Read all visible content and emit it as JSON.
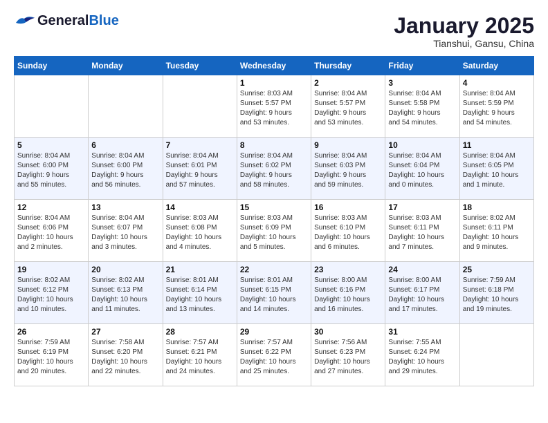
{
  "header": {
    "logo_general": "General",
    "logo_blue": "Blue",
    "calendar_title": "January 2025",
    "calendar_subtitle": "Tianshui, Gansu, China"
  },
  "days_of_week": [
    "Sunday",
    "Monday",
    "Tuesday",
    "Wednesday",
    "Thursday",
    "Friday",
    "Saturday"
  ],
  "weeks": [
    [
      {
        "day": "",
        "info": ""
      },
      {
        "day": "",
        "info": ""
      },
      {
        "day": "",
        "info": ""
      },
      {
        "day": "1",
        "info": "Sunrise: 8:03 AM\nSunset: 5:57 PM\nDaylight: 9 hours\nand 53 minutes."
      },
      {
        "day": "2",
        "info": "Sunrise: 8:04 AM\nSunset: 5:57 PM\nDaylight: 9 hours\nand 53 minutes."
      },
      {
        "day": "3",
        "info": "Sunrise: 8:04 AM\nSunset: 5:58 PM\nDaylight: 9 hours\nand 54 minutes."
      },
      {
        "day": "4",
        "info": "Sunrise: 8:04 AM\nSunset: 5:59 PM\nDaylight: 9 hours\nand 54 minutes."
      }
    ],
    [
      {
        "day": "5",
        "info": "Sunrise: 8:04 AM\nSunset: 6:00 PM\nDaylight: 9 hours\nand 55 minutes."
      },
      {
        "day": "6",
        "info": "Sunrise: 8:04 AM\nSunset: 6:00 PM\nDaylight: 9 hours\nand 56 minutes."
      },
      {
        "day": "7",
        "info": "Sunrise: 8:04 AM\nSunset: 6:01 PM\nDaylight: 9 hours\nand 57 minutes."
      },
      {
        "day": "8",
        "info": "Sunrise: 8:04 AM\nSunset: 6:02 PM\nDaylight: 9 hours\nand 58 minutes."
      },
      {
        "day": "9",
        "info": "Sunrise: 8:04 AM\nSunset: 6:03 PM\nDaylight: 9 hours\nand 59 minutes."
      },
      {
        "day": "10",
        "info": "Sunrise: 8:04 AM\nSunset: 6:04 PM\nDaylight: 10 hours\nand 0 minutes."
      },
      {
        "day": "11",
        "info": "Sunrise: 8:04 AM\nSunset: 6:05 PM\nDaylight: 10 hours\nand 1 minute."
      }
    ],
    [
      {
        "day": "12",
        "info": "Sunrise: 8:04 AM\nSunset: 6:06 PM\nDaylight: 10 hours\nand 2 minutes."
      },
      {
        "day": "13",
        "info": "Sunrise: 8:04 AM\nSunset: 6:07 PM\nDaylight: 10 hours\nand 3 minutes."
      },
      {
        "day": "14",
        "info": "Sunrise: 8:03 AM\nSunset: 6:08 PM\nDaylight: 10 hours\nand 4 minutes."
      },
      {
        "day": "15",
        "info": "Sunrise: 8:03 AM\nSunset: 6:09 PM\nDaylight: 10 hours\nand 5 minutes."
      },
      {
        "day": "16",
        "info": "Sunrise: 8:03 AM\nSunset: 6:10 PM\nDaylight: 10 hours\nand 6 minutes."
      },
      {
        "day": "17",
        "info": "Sunrise: 8:03 AM\nSunset: 6:11 PM\nDaylight: 10 hours\nand 7 minutes."
      },
      {
        "day": "18",
        "info": "Sunrise: 8:02 AM\nSunset: 6:11 PM\nDaylight: 10 hours\nand 9 minutes."
      }
    ],
    [
      {
        "day": "19",
        "info": "Sunrise: 8:02 AM\nSunset: 6:12 PM\nDaylight: 10 hours\nand 10 minutes."
      },
      {
        "day": "20",
        "info": "Sunrise: 8:02 AM\nSunset: 6:13 PM\nDaylight: 10 hours\nand 11 minutes."
      },
      {
        "day": "21",
        "info": "Sunrise: 8:01 AM\nSunset: 6:14 PM\nDaylight: 10 hours\nand 13 minutes."
      },
      {
        "day": "22",
        "info": "Sunrise: 8:01 AM\nSunset: 6:15 PM\nDaylight: 10 hours\nand 14 minutes."
      },
      {
        "day": "23",
        "info": "Sunrise: 8:00 AM\nSunset: 6:16 PM\nDaylight: 10 hours\nand 16 minutes."
      },
      {
        "day": "24",
        "info": "Sunrise: 8:00 AM\nSunset: 6:17 PM\nDaylight: 10 hours\nand 17 minutes."
      },
      {
        "day": "25",
        "info": "Sunrise: 7:59 AM\nSunset: 6:18 PM\nDaylight: 10 hours\nand 19 minutes."
      }
    ],
    [
      {
        "day": "26",
        "info": "Sunrise: 7:59 AM\nSunset: 6:19 PM\nDaylight: 10 hours\nand 20 minutes."
      },
      {
        "day": "27",
        "info": "Sunrise: 7:58 AM\nSunset: 6:20 PM\nDaylight: 10 hours\nand 22 minutes."
      },
      {
        "day": "28",
        "info": "Sunrise: 7:57 AM\nSunset: 6:21 PM\nDaylight: 10 hours\nand 24 minutes."
      },
      {
        "day": "29",
        "info": "Sunrise: 7:57 AM\nSunset: 6:22 PM\nDaylight: 10 hours\nand 25 minutes."
      },
      {
        "day": "30",
        "info": "Sunrise: 7:56 AM\nSunset: 6:23 PM\nDaylight: 10 hours\nand 27 minutes."
      },
      {
        "day": "31",
        "info": "Sunrise: 7:55 AM\nSunset: 6:24 PM\nDaylight: 10 hours\nand 29 minutes."
      },
      {
        "day": "",
        "info": ""
      }
    ]
  ]
}
